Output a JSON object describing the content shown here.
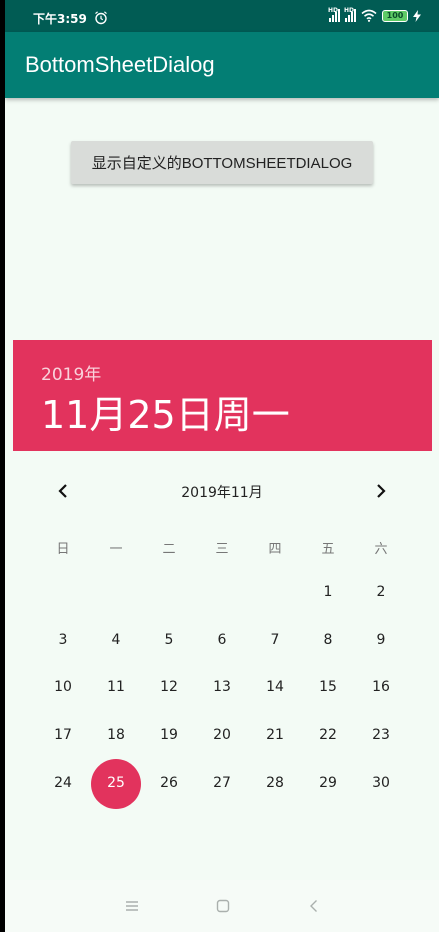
{
  "status_bar": {
    "time": "下午3:59",
    "battery": "100",
    "icons": [
      "alarm-icon",
      "signal-icon",
      "signal-icon",
      "wifi-icon",
      "battery-icon",
      "charging-icon"
    ]
  },
  "app_bar": {
    "title": "BottomSheetDialog"
  },
  "main": {
    "button_label": "显示自定义的BOTTOMSHEETDIALOG"
  },
  "date_picker": {
    "year": "2019年",
    "date": "11月25日周一",
    "month_label": "2019年11月",
    "weekdays": [
      "日",
      "一",
      "二",
      "三",
      "四",
      "五",
      "六"
    ],
    "weeks": [
      [
        "",
        "",
        "",
        "",
        "",
        "1",
        "2"
      ],
      [
        "3",
        "4",
        "5",
        "6",
        "7",
        "8",
        "9"
      ],
      [
        "10",
        "11",
        "12",
        "13",
        "14",
        "15",
        "16"
      ],
      [
        "17",
        "18",
        "19",
        "20",
        "21",
        "22",
        "23"
      ],
      [
        "24",
        "25",
        "26",
        "27",
        "28",
        "29",
        "30"
      ]
    ],
    "selected_day": "25",
    "accent_color": "#e2335d"
  },
  "colors": {
    "app_bar": "#037e74",
    "status_bar": "#015c54",
    "background": "#f3fbf5"
  },
  "nav_bar": {
    "icons": [
      "menu-icon",
      "home-icon",
      "back-icon"
    ]
  }
}
